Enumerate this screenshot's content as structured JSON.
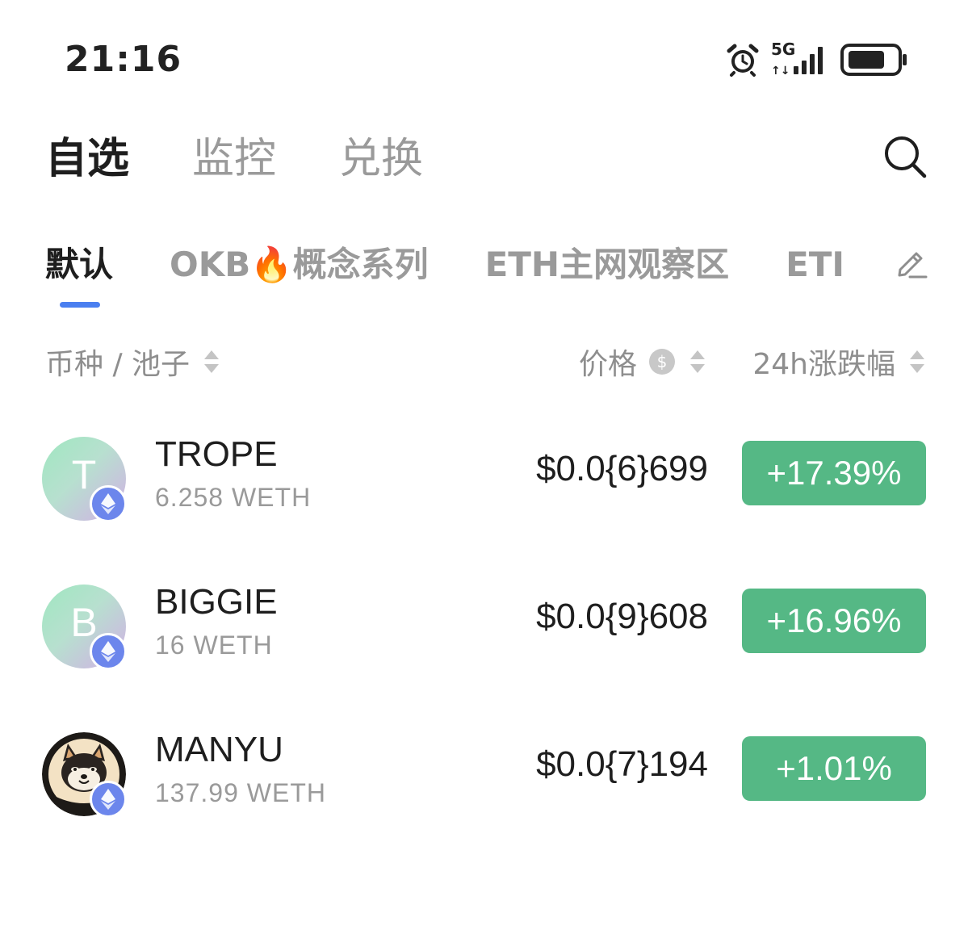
{
  "status_bar": {
    "time": "21:16",
    "icons": [
      "alarm-icon",
      "5g-signal-icon",
      "battery-icon"
    ]
  },
  "main_tabs": [
    {
      "label": "自选",
      "active": true
    },
    {
      "label": "监控",
      "active": false
    },
    {
      "label": "兑换",
      "active": false
    }
  ],
  "sub_tabs": [
    {
      "label": "默认",
      "active": true
    },
    {
      "label": "OKB🔥概念系列",
      "active": false
    },
    {
      "label": "ETH主网观察区",
      "active": false
    },
    {
      "label": "ETI",
      "active": false
    }
  ],
  "columns": {
    "coin": "币种 / 池子",
    "price": "价格",
    "change": "24h涨跌幅"
  },
  "tokens": [
    {
      "symbol": "TROPE",
      "avatar_letter": "T",
      "pool": "6.258 WETH",
      "price": "$0.0{6}699",
      "change": "+17.39%"
    },
    {
      "symbol": "BIGGIE",
      "avatar_letter": "B",
      "pool": "16 WETH",
      "price": "$0.0{9}608",
      "change": "+16.96%"
    },
    {
      "symbol": "MANYU",
      "avatar_letter": "",
      "pool": "137.99 WETH",
      "price": "$0.0{7}194",
      "change": "+1.01%"
    }
  ],
  "colors": {
    "accent": "#4a7ff0",
    "positive": "#55b885",
    "chain_badge": "#6c86ec"
  }
}
